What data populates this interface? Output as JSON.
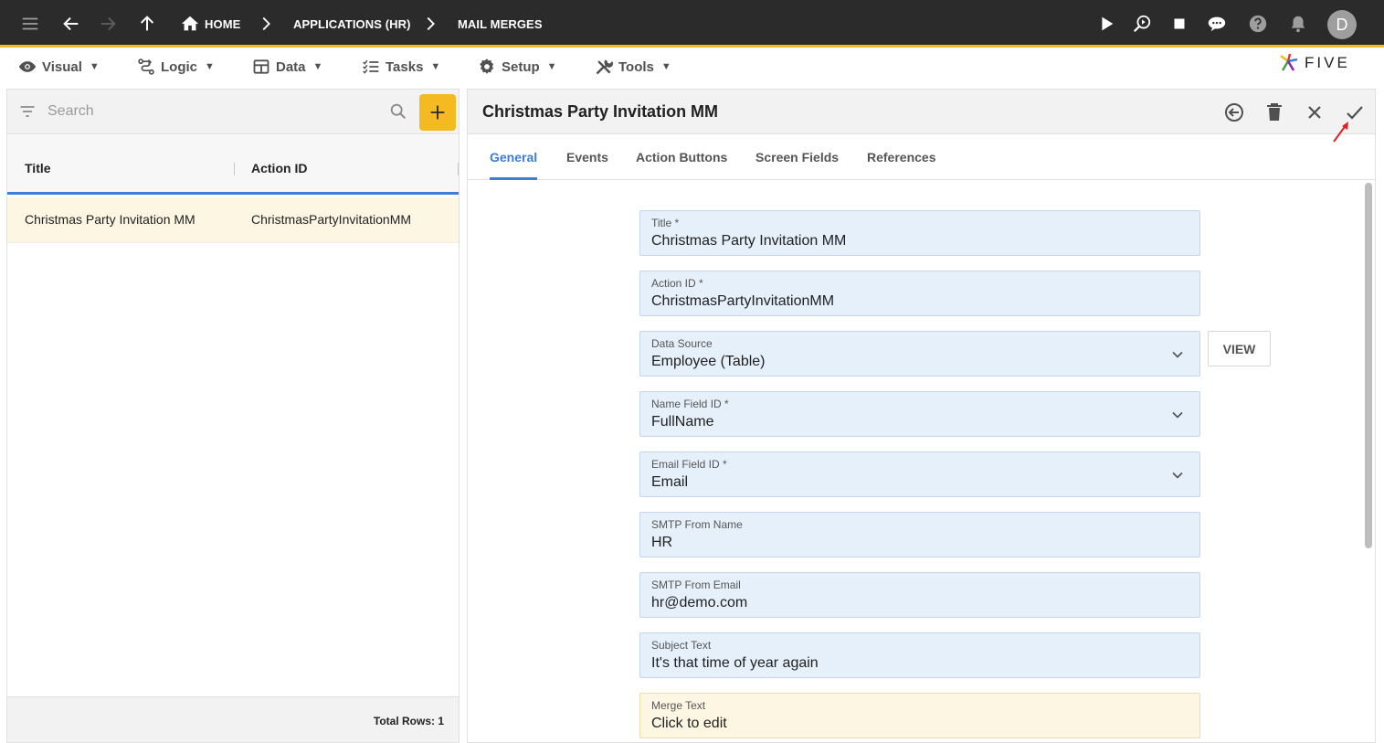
{
  "topbar": {
    "breadcrumbs": [
      "HOME",
      "APPLICATIONS (HR)",
      "MAIL MERGES"
    ],
    "avatar_initial": "D"
  },
  "menu": {
    "items": [
      {
        "label": "Visual",
        "icon": "eye-icon"
      },
      {
        "label": "Logic",
        "icon": "logic-icon"
      },
      {
        "label": "Data",
        "icon": "table-icon"
      },
      {
        "label": "Tasks",
        "icon": "checklist-icon"
      },
      {
        "label": "Setup",
        "icon": "gear-icon"
      },
      {
        "label": "Tools",
        "icon": "tools-icon"
      }
    ],
    "caret": "▼",
    "logo_text": "FIVE"
  },
  "list": {
    "search_placeholder": "Search",
    "columns": [
      "Title",
      "Action ID"
    ],
    "rows": [
      {
        "title": "Christmas Party Invitation MM",
        "action_id": "ChristmasPartyInvitationMM"
      }
    ],
    "total_rows": "Total Rows: 1"
  },
  "form": {
    "title": "Christmas Party Invitation MM",
    "tabs": [
      "General",
      "Events",
      "Action Buttons",
      "Screen Fields",
      "References"
    ],
    "view_label": "VIEW",
    "fields": [
      {
        "label": "Title *",
        "value": "Christmas Party Invitation MM"
      },
      {
        "label": "Action ID *",
        "value": "ChristmasPartyInvitationMM"
      },
      {
        "label": "Data Source",
        "value": "Employee (Table)"
      },
      {
        "label": "Name Field ID *",
        "value": "FullName"
      },
      {
        "label": "Email Field ID *",
        "value": "Email"
      },
      {
        "label": "SMTP From Name",
        "value": "HR"
      },
      {
        "label": "SMTP From Email",
        "value": "hr@demo.com"
      },
      {
        "label": "Subject Text",
        "value": "It's that time of year again"
      },
      {
        "label": "Merge Text",
        "value": "Click to edit"
      }
    ]
  },
  "colors": {
    "accent": "#3b7dd8",
    "brand_yellow": "#f5b921",
    "topbar": "#2b2b2b",
    "field_bg": "#e6f0fb",
    "selected_row": "#fdf6e3"
  }
}
